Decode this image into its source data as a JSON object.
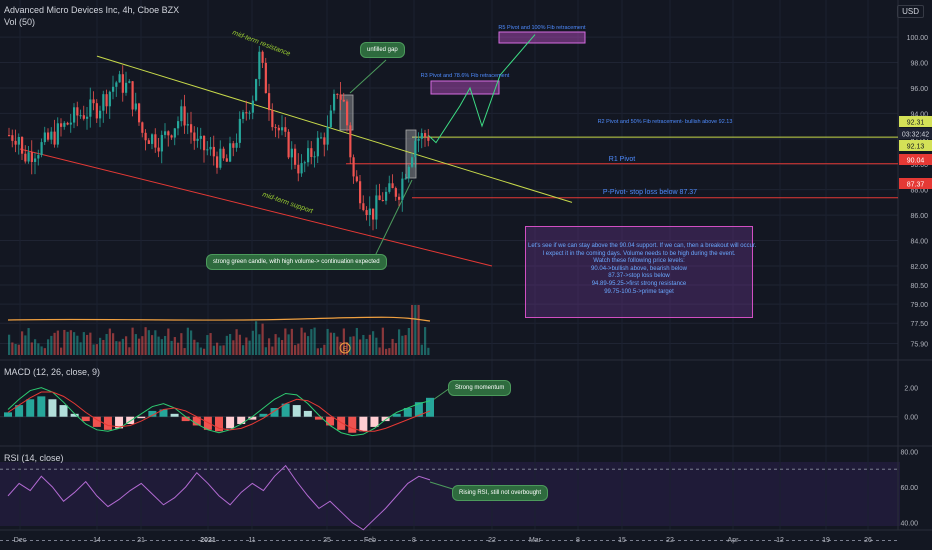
{
  "header": {
    "title": "Advanced Micro Devices Inc, 4h, Cboe BZX",
    "vol": "Vol (50)",
    "macd": "MACD (12, 26, close, 9)",
    "rsi": "RSI (14, close)",
    "currency": "USD"
  },
  "price_labels": [
    {
      "text": "92.31",
      "bg": "#d4e157",
      "fg": "#131722"
    },
    {
      "text": "03:32:42",
      "bg": "#1e2233",
      "fg": "#d1d4dc"
    },
    {
      "text": "92.13",
      "bg": "#d4e157",
      "fg": "#131722"
    },
    {
      "text": "90.04",
      "bg": "#e53935",
      "fg": "#ffffff"
    },
    {
      "text": "87.37",
      "bg": "#e53935",
      "fg": "#ffffff"
    }
  ],
  "annotations": {
    "mid_resistance": "mid-term resistance",
    "mid_support": "mid-term support",
    "r5": "R5 Pivot and 100% Fib retracement",
    "r3": "R3 Pivot and 78.6% Fib retracement",
    "r2": "R2 Pivot and 50% Fib retracement- bullish above 92.13",
    "r1": "R1 Pivot",
    "pp": "P-Pivot- stop loss below 87.37",
    "unfilled_gap": "unfilled gap",
    "green_candle": "strong green candle, with high volume-> continuation expected",
    "strong_momentum": "Strong momentum",
    "rsi_note": "Rising RSI, still not overbought",
    "earnings": "E"
  },
  "notes": [
    "Let's see if we can stay above the 90.04 support. If we can, then a breakout will occur.",
    "I expect it in the coming days. Volume needs to be high during the event.",
    "Watch these following price levels:",
    "90.04->bullish above, bearish below",
    "87.37->stop loss below",
    "94.89-95.25->first strong resistance",
    "99.75-100.5->prime target"
  ],
  "colors": {
    "bg": "#131722",
    "up": "#26a69a",
    "down": "#ef5350",
    "yellow": "#c7d94a",
    "red_line": "#e53935",
    "ma": "#f0a040",
    "purple": "#b26ad2",
    "blue_text": "#4f8cff"
  },
  "chart_data": [
    {
      "type": "candlestick",
      "title": "Advanced Micro Devices Inc, 4h, Cboe BZX",
      "x_ticks": [
        "Dec",
        "14",
        "21",
        "2021",
        "11",
        "25",
        "Feb",
        "8",
        "22",
        "Mar",
        "8",
        "15",
        "22",
        "Apr",
        "12",
        "19",
        "26"
      ],
      "y_ticks": [
        75.9,
        77.5,
        79.0,
        80.5,
        82.0,
        84.0,
        86.0,
        88.0,
        90.0,
        92.0,
        94.0,
        96.0,
        98.0,
        100.0
      ],
      "ylim": [
        75.0,
        101.5
      ],
      "close_path": [
        {
          "x": "Dec",
          "y": 90.5
        },
        {
          "x": "Dec 7",
          "y": 91.5
        },
        {
          "x": "Dec 10",
          "y": 93.8
        },
        {
          "x": "14",
          "y": 94.5
        },
        {
          "x": "Dec 16",
          "y": 96.5
        },
        {
          "x": "Dec 18",
          "y": 96.0
        },
        {
          "x": "21",
          "y": 92.5
        },
        {
          "x": "Dec 23",
          "y": 91.8
        },
        {
          "x": "Dec 28",
          "y": 94.0
        },
        {
          "x": "Dec 30",
          "y": 91.5
        },
        {
          "x": "2021",
          "y": 91.0
        },
        {
          "x": "Jan 6",
          "y": 90.0
        },
        {
          "x": "Jan 8",
          "y": 93.5
        },
        {
          "x": "11",
          "y": 95.5
        },
        {
          "x": "Jan 12",
          "y": 98.5
        },
        {
          "x": "Jan 14",
          "y": 93.5
        },
        {
          "x": "Jan 19",
          "y": 89.5
        },
        {
          "x": "Jan 21",
          "y": 91.5
        },
        {
          "x": "25",
          "y": 92.5
        },
        {
          "x": "Jan 26",
          "y": 96.0
        },
        {
          "x": "Jan 27",
          "y": 94.5
        },
        {
          "x": "Jan 28",
          "y": 89.0
        },
        {
          "x": "Feb",
          "y": 86.0
        },
        {
          "x": "Feb 3",
          "y": 87.5
        },
        {
          "x": "Feb 5",
          "y": 88.0
        },
        {
          "x": "8",
          "y": 92.0
        },
        {
          "x": "Feb 9",
          "y": 92.3
        }
      ],
      "projection": [
        {
          "x": "Feb 9",
          "y": 92.3
        },
        {
          "x": "Feb 11",
          "y": 91.7
        },
        {
          "x": "Feb 14",
          "y": 94.6
        },
        {
          "x": "Feb 17",
          "y": 96.0
        },
        {
          "x": "Feb 20",
          "y": 93.0
        },
        {
          "x": "Feb 24",
          "y": 97.0
        },
        {
          "x": "Mar",
          "y": 100.2
        }
      ],
      "levels": [
        {
          "name": "R2 Pivot",
          "value": 92.13,
          "color": "yellow"
        },
        {
          "name": "R1 Pivot",
          "value": 90.04,
          "color": "red"
        },
        {
          "name": "P-Pivot",
          "value": 87.37,
          "color": "red"
        },
        {
          "name": "R3 zone",
          "low": 94.89,
          "high": 95.25
        },
        {
          "name": "R5 zone",
          "low": 99.75,
          "high": 100.5
        }
      ],
      "trendlines": [
        {
          "name": "mid-term resistance",
          "from": {
            "x": "Dec 14",
            "y": 98.5
          },
          "to": {
            "x": "Mar 7",
            "y": 87.0
          }
        },
        {
          "name": "mid-term support",
          "from": {
            "x": "Dec",
            "y": 91.2
          },
          "to": {
            "x": "Feb 22",
            "y": 82.0
          }
        }
      ],
      "volume": {
        "ma_period": 50,
        "level": "low",
        "spike_bar": "Feb 8"
      }
    },
    {
      "type": "macd",
      "title": "MACD (12, 26, close, 9)",
      "y_ticks": [
        0.0,
        2.0
      ],
      "ylim": [
        -1.6,
        2.8
      ],
      "histogram": [
        0.3,
        0.8,
        1.2,
        1.4,
        1.2,
        0.8,
        0.2,
        -0.3,
        -0.7,
        -0.9,
        -0.8,
        -0.5,
        -0.1,
        0.4,
        0.5,
        0.2,
        -0.3,
        -0.6,
        -0.9,
        -1.0,
        -0.8,
        -0.5,
        -0.2,
        0.2,
        0.6,
        0.9,
        0.8,
        0.4,
        -0.2,
        -0.6,
        -0.9,
        -1.1,
        -1.0,
        -0.7,
        -0.3,
        0.2,
        0.6,
        1.0,
        1.3
      ],
      "macd_line": [
        0.5,
        1.2,
        1.8,
        2.0,
        1.7,
        1.0,
        0.2,
        -0.5,
        -0.9,
        -1.0,
        -0.8,
        -0.3,
        0.2,
        0.7,
        0.9,
        0.6,
        0.0,
        -0.5,
        -0.9,
        -1.1,
        -0.9,
        -0.5,
        0.0,
        0.6,
        1.2,
        1.6,
        1.5,
        0.9,
        0.1,
        -0.6,
        -1.1,
        -1.3,
        -1.2,
        -0.8,
        -0.2,
        0.3,
        0.6,
        0.9,
        1.1
      ],
      "signal_line": [
        0.3,
        0.8,
        1.3,
        1.7,
        1.7,
        1.4,
        0.9,
        0.3,
        -0.2,
        -0.6,
        -0.7,
        -0.6,
        -0.3,
        0.1,
        0.5,
        0.6,
        0.4,
        0.0,
        -0.4,
        -0.8,
        -0.9,
        -0.8,
        -0.5,
        -0.1,
        0.4,
        0.9,
        1.2,
        1.1,
        0.7,
        0.1,
        -0.4,
        -0.8,
        -1.0,
        -1.0,
        -0.8,
        -0.5,
        -0.2,
        0.1,
        0.4
      ]
    },
    {
      "type": "line",
      "title": "RSI (14, close)",
      "y_ticks": [
        40.0,
        60.0,
        80.0
      ],
      "ylim": [
        28,
        83
      ],
      "bands": [
        70,
        30
      ],
      "values": [
        55,
        62,
        58,
        66,
        60,
        52,
        57,
        63,
        55,
        49,
        53,
        58,
        62,
        56,
        50,
        54,
        60,
        68,
        62,
        55,
        50,
        57,
        62,
        58,
        66,
        72,
        63,
        55,
        48,
        52,
        46,
        40,
        36,
        42,
        48,
        55,
        62,
        66,
        64
      ]
    }
  ]
}
